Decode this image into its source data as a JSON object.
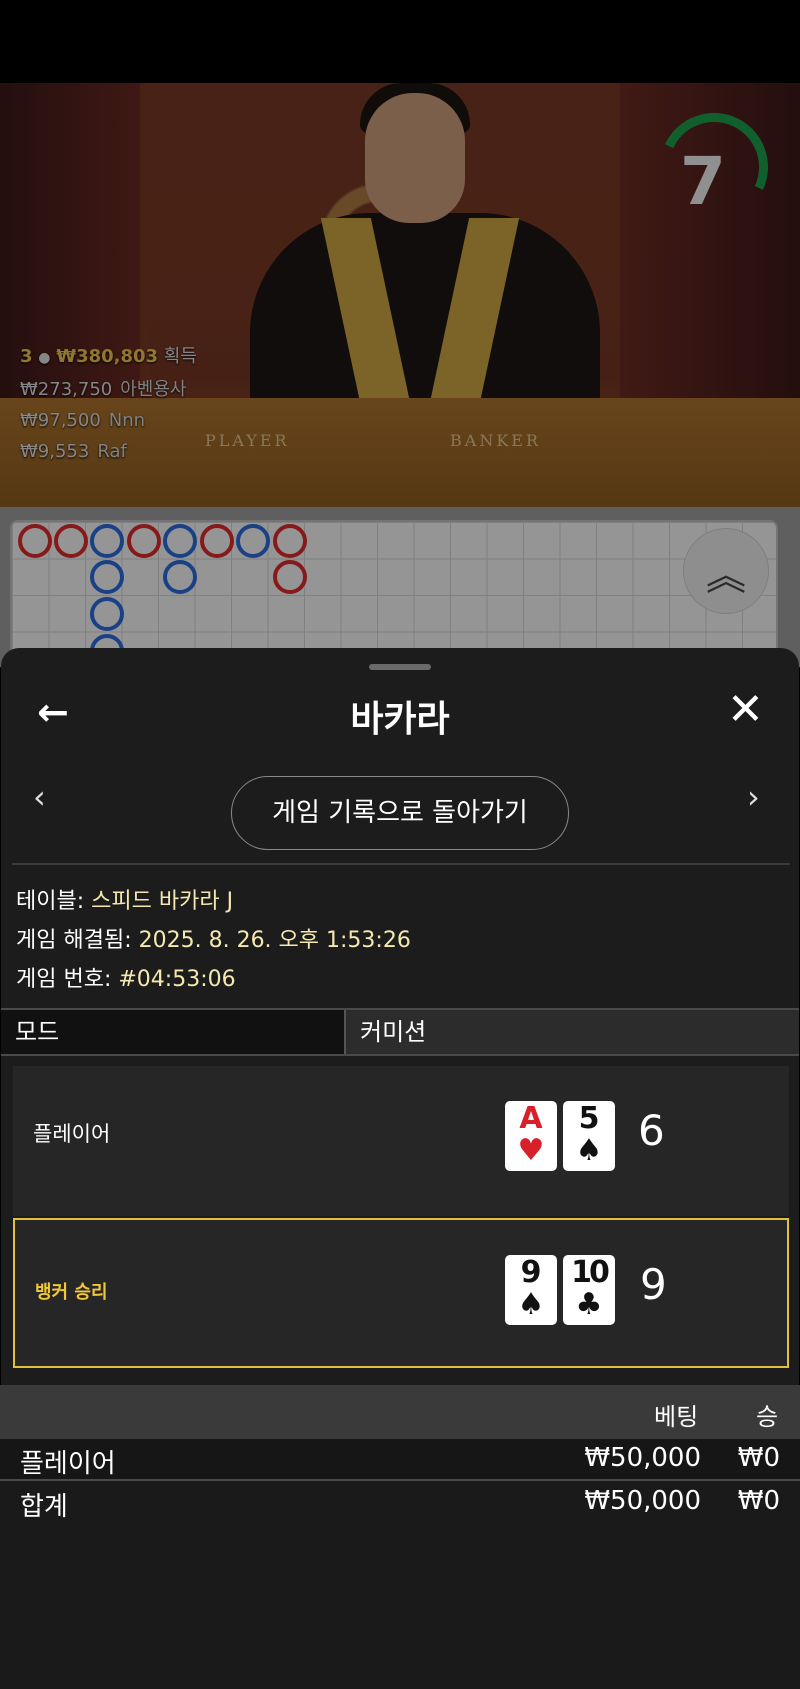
{
  "stream": {
    "timer": "7",
    "table_labels": {
      "player": "PLAYER",
      "banker": "BANKER"
    },
    "winners": {
      "count": "3",
      "total": "₩380,803",
      "total_suffix": "획득",
      "entries": [
        {
          "amount": "₩273,750",
          "name": "아벤용사"
        },
        {
          "amount": "₩97,500",
          "name": "Nnn"
        },
        {
          "amount": "₩9,553",
          "name": "Raf"
        }
      ]
    }
  },
  "roadmap": {
    "up_icon": "double-chevron-up-icon"
  },
  "sheet": {
    "title": "바카라",
    "back_icon": "←",
    "close_icon": "✕",
    "prev_icon": "‹",
    "next_icon": "›",
    "return_button": "게임 기록으로 돌아가기",
    "info": {
      "table_label": "테이블:",
      "table_value": "스피드 바카라 J",
      "resolved_label": "게임 해결됨:",
      "resolved_value": "2025. 8. 26. 오후 1:53:26",
      "game_no_label": "게임 번호:",
      "game_no_value": "#04:53:06"
    },
    "tabs": {
      "mode": "모드",
      "commission": "커미션"
    },
    "hands": [
      {
        "label": "플레이어",
        "cards": [
          {
            "rank": "A",
            "suit": "♥"
          },
          {
            "rank": "5",
            "suit": "♠"
          }
        ],
        "score": "6"
      },
      {
        "label": "뱅커 승리",
        "cards": [
          {
            "rank": "9",
            "suit": "♠"
          },
          {
            "rank": "10",
            "suit": "♣"
          }
        ],
        "score": "9"
      }
    ],
    "bets": {
      "header": {
        "bet": "베팅",
        "win": "승"
      },
      "rows": [
        {
          "name": "플레이어",
          "bet": "₩50,000",
          "win": "₩0"
        }
      ],
      "total": {
        "name": "합계",
        "bet": "₩50,000",
        "win": "₩0"
      }
    }
  },
  "colors": {
    "accent_gold": "#f0c838",
    "timer_green": "#1a9a4a",
    "player_blue": "#2a6ad8",
    "banker_red": "#d82a2a"
  }
}
